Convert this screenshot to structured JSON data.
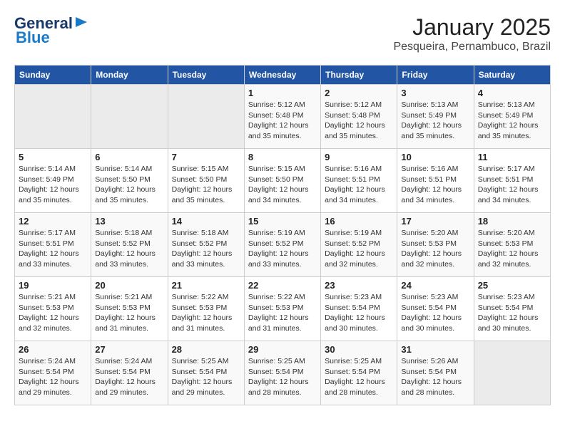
{
  "header": {
    "logo_line1": "General",
    "logo_line2": "Blue",
    "title": "January 2025",
    "subtitle": "Pesqueira, Pernambuco, Brazil"
  },
  "days_of_week": [
    "Sunday",
    "Monday",
    "Tuesday",
    "Wednesday",
    "Thursday",
    "Friday",
    "Saturday"
  ],
  "weeks": [
    [
      {
        "day": "",
        "info": ""
      },
      {
        "day": "",
        "info": ""
      },
      {
        "day": "",
        "info": ""
      },
      {
        "day": "1",
        "info": "Sunrise: 5:12 AM\nSunset: 5:48 PM\nDaylight: 12 hours\nand 35 minutes."
      },
      {
        "day": "2",
        "info": "Sunrise: 5:12 AM\nSunset: 5:48 PM\nDaylight: 12 hours\nand 35 minutes."
      },
      {
        "day": "3",
        "info": "Sunrise: 5:13 AM\nSunset: 5:49 PM\nDaylight: 12 hours\nand 35 minutes."
      },
      {
        "day": "4",
        "info": "Sunrise: 5:13 AM\nSunset: 5:49 PM\nDaylight: 12 hours\nand 35 minutes."
      }
    ],
    [
      {
        "day": "5",
        "info": "Sunrise: 5:14 AM\nSunset: 5:49 PM\nDaylight: 12 hours\nand 35 minutes."
      },
      {
        "day": "6",
        "info": "Sunrise: 5:14 AM\nSunset: 5:50 PM\nDaylight: 12 hours\nand 35 minutes."
      },
      {
        "day": "7",
        "info": "Sunrise: 5:15 AM\nSunset: 5:50 PM\nDaylight: 12 hours\nand 35 minutes."
      },
      {
        "day": "8",
        "info": "Sunrise: 5:15 AM\nSunset: 5:50 PM\nDaylight: 12 hours\nand 34 minutes."
      },
      {
        "day": "9",
        "info": "Sunrise: 5:16 AM\nSunset: 5:51 PM\nDaylight: 12 hours\nand 34 minutes."
      },
      {
        "day": "10",
        "info": "Sunrise: 5:16 AM\nSunset: 5:51 PM\nDaylight: 12 hours\nand 34 minutes."
      },
      {
        "day": "11",
        "info": "Sunrise: 5:17 AM\nSunset: 5:51 PM\nDaylight: 12 hours\nand 34 minutes."
      }
    ],
    [
      {
        "day": "12",
        "info": "Sunrise: 5:17 AM\nSunset: 5:51 PM\nDaylight: 12 hours\nand 33 minutes."
      },
      {
        "day": "13",
        "info": "Sunrise: 5:18 AM\nSunset: 5:52 PM\nDaylight: 12 hours\nand 33 minutes."
      },
      {
        "day": "14",
        "info": "Sunrise: 5:18 AM\nSunset: 5:52 PM\nDaylight: 12 hours\nand 33 minutes."
      },
      {
        "day": "15",
        "info": "Sunrise: 5:19 AM\nSunset: 5:52 PM\nDaylight: 12 hours\nand 33 minutes."
      },
      {
        "day": "16",
        "info": "Sunrise: 5:19 AM\nSunset: 5:52 PM\nDaylight: 12 hours\nand 32 minutes."
      },
      {
        "day": "17",
        "info": "Sunrise: 5:20 AM\nSunset: 5:53 PM\nDaylight: 12 hours\nand 32 minutes."
      },
      {
        "day": "18",
        "info": "Sunrise: 5:20 AM\nSunset: 5:53 PM\nDaylight: 12 hours\nand 32 minutes."
      }
    ],
    [
      {
        "day": "19",
        "info": "Sunrise: 5:21 AM\nSunset: 5:53 PM\nDaylight: 12 hours\nand 32 minutes."
      },
      {
        "day": "20",
        "info": "Sunrise: 5:21 AM\nSunset: 5:53 PM\nDaylight: 12 hours\nand 31 minutes."
      },
      {
        "day": "21",
        "info": "Sunrise: 5:22 AM\nSunset: 5:53 PM\nDaylight: 12 hours\nand 31 minutes."
      },
      {
        "day": "22",
        "info": "Sunrise: 5:22 AM\nSunset: 5:53 PM\nDaylight: 12 hours\nand 31 minutes."
      },
      {
        "day": "23",
        "info": "Sunrise: 5:23 AM\nSunset: 5:54 PM\nDaylight: 12 hours\nand 30 minutes."
      },
      {
        "day": "24",
        "info": "Sunrise: 5:23 AM\nSunset: 5:54 PM\nDaylight: 12 hours\nand 30 minutes."
      },
      {
        "day": "25",
        "info": "Sunrise: 5:23 AM\nSunset: 5:54 PM\nDaylight: 12 hours\nand 30 minutes."
      }
    ],
    [
      {
        "day": "26",
        "info": "Sunrise: 5:24 AM\nSunset: 5:54 PM\nDaylight: 12 hours\nand 29 minutes."
      },
      {
        "day": "27",
        "info": "Sunrise: 5:24 AM\nSunset: 5:54 PM\nDaylight: 12 hours\nand 29 minutes."
      },
      {
        "day": "28",
        "info": "Sunrise: 5:25 AM\nSunset: 5:54 PM\nDaylight: 12 hours\nand 29 minutes."
      },
      {
        "day": "29",
        "info": "Sunrise: 5:25 AM\nSunset: 5:54 PM\nDaylight: 12 hours\nand 28 minutes."
      },
      {
        "day": "30",
        "info": "Sunrise: 5:25 AM\nSunset: 5:54 PM\nDaylight: 12 hours\nand 28 minutes."
      },
      {
        "day": "31",
        "info": "Sunrise: 5:26 AM\nSunset: 5:54 PM\nDaylight: 12 hours\nand 28 minutes."
      },
      {
        "day": "",
        "info": ""
      }
    ]
  ]
}
